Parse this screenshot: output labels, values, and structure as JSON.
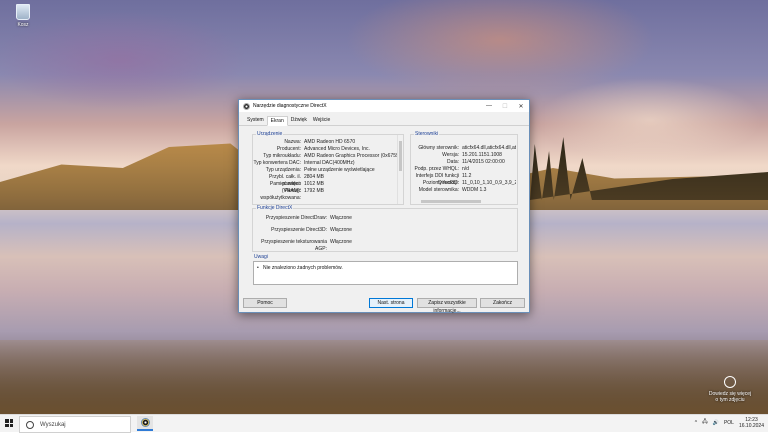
{
  "desktop": {
    "recycle_bin_label": "Kosz",
    "activation_text": "Dowiedz się więcej o tym zdjęciu",
    "activation_icon": "camera-icon"
  },
  "window": {
    "title": "Narzędzie diagnostyczne DirectX",
    "controls": {
      "minimize": "—",
      "maximize": "☐",
      "close": "✕"
    },
    "tabs": [
      "System",
      "Ekran",
      "Dźwięk",
      "Wejście"
    ],
    "active_tab": "Ekran",
    "device": {
      "title": "Urządzenie",
      "rows": [
        {
          "k": "Nazwa:",
          "v": "AMD Radeon HD 6570"
        },
        {
          "k": "Producent:",
          "v": "Advanced Micro Devices, Inc."
        },
        {
          "k": "Typ mikroukładu:",
          "v": "AMD Radeon Graphics Processor (0x6759)"
        },
        {
          "k": "Typ konwertera DAC:",
          "v": "Internal DAC(400MHz)"
        },
        {
          "k": "Typ urządzenia:",
          "v": "Pełne urządzenie wyświetlające"
        },
        {
          "k": "Przybl. całk. il. pamięci:",
          "v": "2804 MB"
        },
        {
          "k": "Pamięć wideo (VRAM):",
          "v": "1012 MB"
        },
        {
          "k": "Pamięć współużytkowana:",
          "v": "1792 MB"
        }
      ]
    },
    "drivers": {
      "title": "Sterowniki",
      "rows": [
        {
          "k": "Główny sterownik:",
          "v": "aticfx64.dll,aticfx64.dll,aticfx64.d"
        },
        {
          "k": "Wersja:",
          "v": "15.201.1151.1008"
        },
        {
          "k": "Data:",
          "v": "11/4/2015 02:00:00"
        },
        {
          "k": "Podp. przez WHQL:",
          "v": "n/d"
        },
        {
          "k": "Interfejs DDI funkcji Direct3D:",
          "v": "11.2"
        },
        {
          "k": "Poziomy funkcji:",
          "v": "11_0,10_1,10_0,9_3,9_2,9_1"
        },
        {
          "k": "Model sterownika:",
          "v": "WDDM 1.3"
        }
      ]
    },
    "directx_features": {
      "title": "Funkcje DirectX",
      "rows": [
        {
          "k": "Przyspieszenie DirectDraw:",
          "v": "Włączone"
        },
        {
          "k": "Przyspieszenie Direct3D:",
          "v": "Włączone"
        },
        {
          "k": "Przyspieszenie teksturowania AGP:",
          "v": "Włączone"
        }
      ]
    },
    "notes": {
      "title": "Uwagi",
      "items": [
        "Nie znaleziono żadnych problemów."
      ]
    },
    "buttons": {
      "help": "Pomoc",
      "next_page": "Nast. strona",
      "save_all": "Zapisz wszystkie informacje...",
      "close": "Zakończ"
    }
  },
  "taskbar": {
    "search_placeholder": "Wyszukaj",
    "tray_chevron": "^",
    "tray_network": "🖧",
    "tray_volume": "🔊",
    "tray_lang": "POL",
    "time": "12:23",
    "date": "16.10.2024"
  }
}
